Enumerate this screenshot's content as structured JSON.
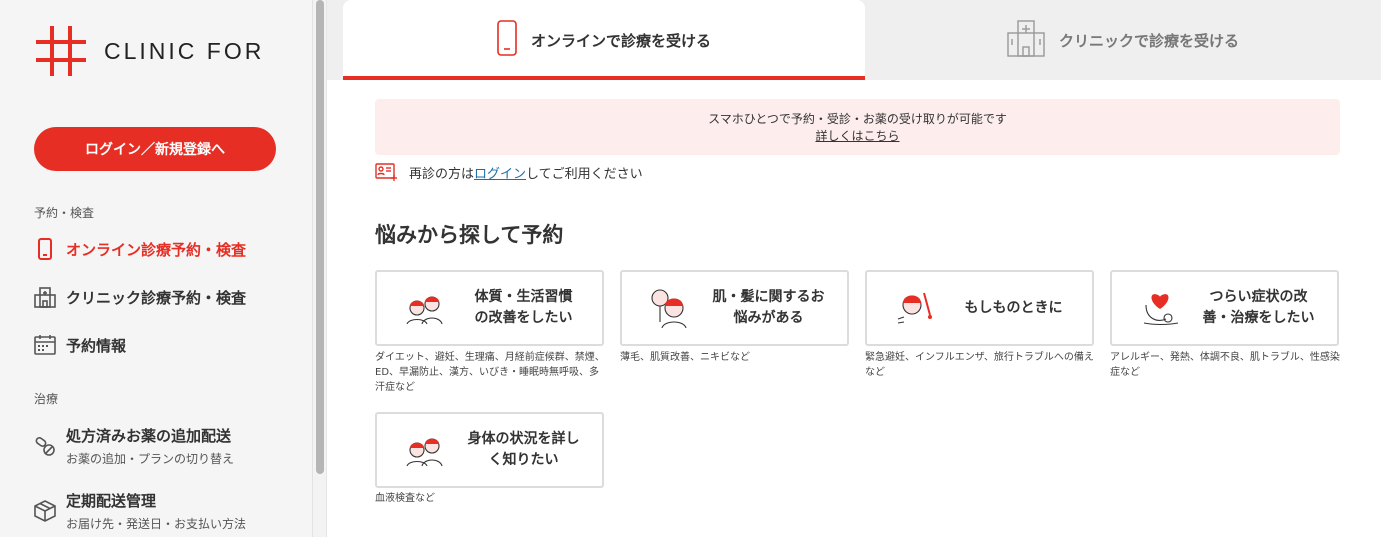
{
  "brand": {
    "name": "CLINIC FOR",
    "accent": "#e62e24"
  },
  "sidebar": {
    "login_button": "ログイン／新規登録へ",
    "section_booking": "予約・検査",
    "items_booking": [
      {
        "label": "オンライン診療予約・検査",
        "icon": "smartphone-icon",
        "active": true
      },
      {
        "label": "クリニック診療予約・検査",
        "icon": "clinic-building-icon"
      },
      {
        "label": "予約情報",
        "icon": "calendar-icon"
      }
    ],
    "section_treatment": "治療",
    "items_treatment": [
      {
        "label": "処方済みお薬の追加配送",
        "sub": "お薬の追加・プランの切り替え",
        "icon": "pill-icon"
      },
      {
        "label": "定期配送管理",
        "sub": "お届け先・発送日・お支払い方法",
        "icon": "box-icon"
      }
    ]
  },
  "tabs": {
    "online": "オンラインで診療を受ける",
    "clinic": "クリニックで診療を受ける"
  },
  "notice": {
    "text": "スマホひとつで予約・受診・お薬の受け取りが可能です",
    "link": "詳しくはこちら"
  },
  "relogin": {
    "before": "再診の方は",
    "link": "ログイン",
    "after": "してご利用ください"
  },
  "heading": "悩みから探して予約",
  "cards": [
    {
      "title": "体質・生活習慣\nの改善をしたい",
      "desc": "ダイエット、避妊、生理痛、月経前症候群、禁煙、ED、早漏防止、漢方、いびき・睡眠時無呼吸、多汗症など",
      "icon": "couple-icon"
    },
    {
      "title": "肌・髪に関するお\n悩みがある",
      "desc": "薄毛、肌質改善、ニキビなど",
      "icon": "mirror-woman-icon"
    },
    {
      "title": "もしものときに",
      "desc": "緊急避妊、インフルエンザ、旅行トラブルへの備えなど",
      "icon": "thermometer-person-icon"
    },
    {
      "title": "つらい症状の改\n善・治療をしたい",
      "desc": "アレルギー、発熱、体調不良、肌トラブル、性感染症など",
      "icon": "heart-stethoscope-icon"
    },
    {
      "title": "身体の状況を詳し\nく知りたい",
      "desc": "血液検査など",
      "icon": "couple-icon"
    }
  ]
}
